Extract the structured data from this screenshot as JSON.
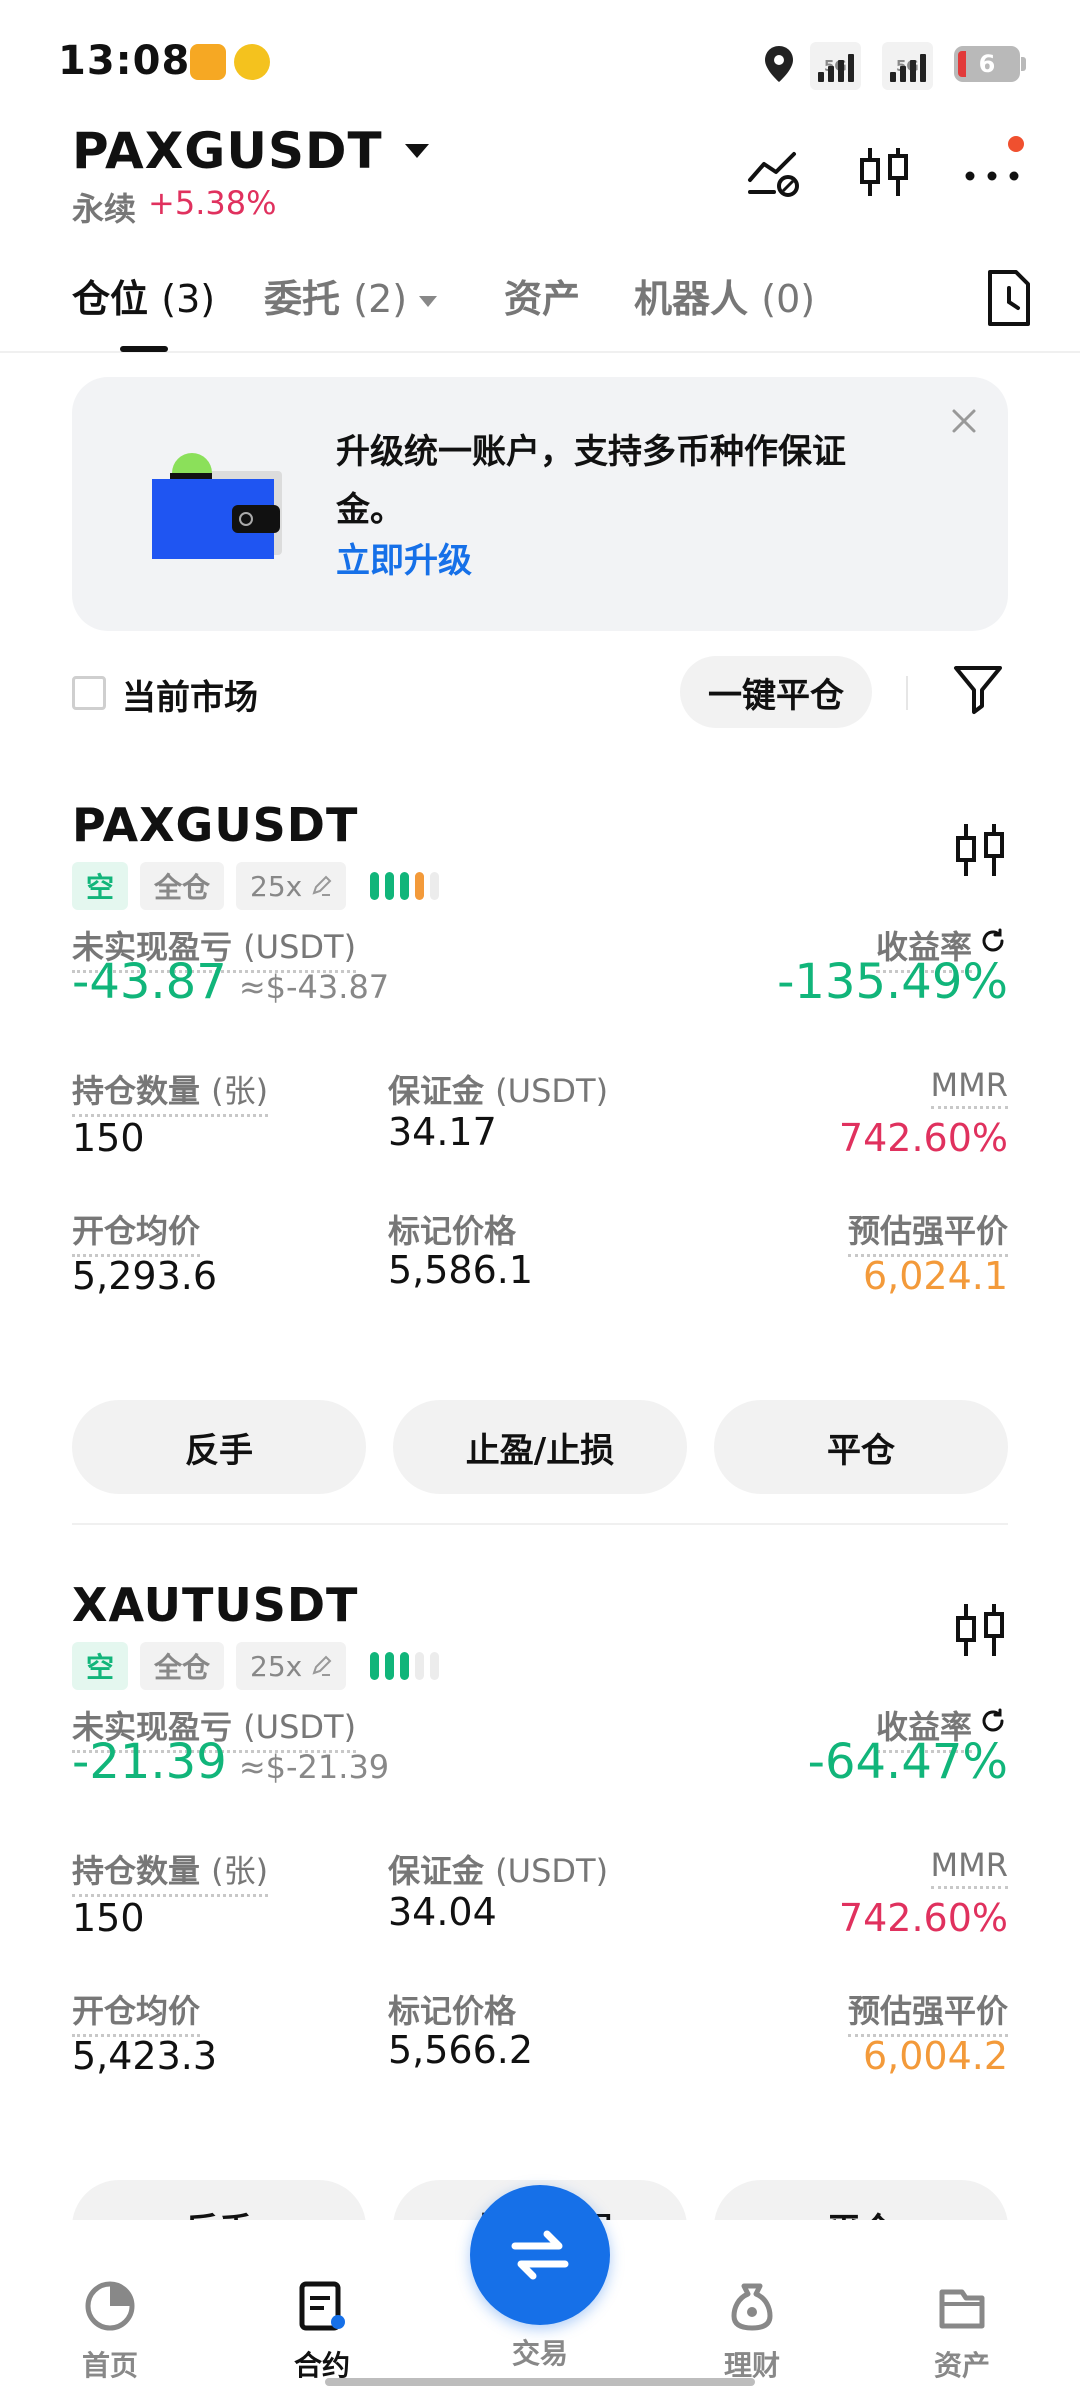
{
  "status_bar": {
    "time": "13:08",
    "signal_1": "5G",
    "signal_2": "5G",
    "battery": "6"
  },
  "header": {
    "symbol": "PAXGUSDT",
    "contract_type": "永续",
    "change": "+5.38%"
  },
  "tabs": [
    {
      "label": "仓位",
      "count": "(3)",
      "active": true
    },
    {
      "label": "委托",
      "count": "(2)"
    },
    {
      "label": "资产",
      "count": ""
    },
    {
      "label": "机器人",
      "count": "(0)"
    }
  ],
  "banner": {
    "text": "升级统一账户，支持多币种作保证金。",
    "link": "立即升级"
  },
  "filter": {
    "current_market": "当前市场",
    "close_all": "一键平仓"
  },
  "labels": {
    "unrealized_pnl": "未实现盈亏",
    "usdt_unit": "(USDT)",
    "roi": "收益率",
    "quantity": "持仓数量",
    "quantity_unit": "(张)",
    "margin": "保证金",
    "mmr": "MMR",
    "entry_price": "开仓均价",
    "mark_price": "标记价格",
    "liq_price": "预估强平价",
    "btn_reverse": "反手",
    "btn_tpsl": "止盈/止损",
    "btn_close": "平仓"
  },
  "positions": [
    {
      "symbol": "PAXGUSDT",
      "side": "空",
      "margin_mode": "全仓",
      "leverage": "25x",
      "risk_level": 4,
      "pnl": "-43.87",
      "pnl_usd": "≈$-43.87",
      "roi": "-135.49%",
      "quantity": "150",
      "margin": "34.17",
      "mmr": "742.60%",
      "entry_price": "5,293.6",
      "mark_price": "5,586.1",
      "liq_price": "6,024.1"
    },
    {
      "symbol": "XAUTUSDT",
      "side": "空",
      "margin_mode": "全仓",
      "leverage": "25x",
      "risk_level": 3,
      "pnl": "-21.39",
      "pnl_usd": "≈$-21.39",
      "roi": "-64.47%",
      "quantity": "150",
      "margin": "34.04",
      "mmr": "742.60%",
      "entry_price": "5,423.3",
      "mark_price": "5,566.2",
      "liq_price": "6,004.2"
    }
  ],
  "bottom_nav": [
    {
      "label": "首页",
      "icon": "home-icon"
    },
    {
      "label": "合约",
      "icon": "futures-icon",
      "active": true
    },
    {
      "label": "交易",
      "icon": "trade-swap-icon"
    },
    {
      "label": "理财",
      "icon": "earn-icon"
    },
    {
      "label": "资产",
      "icon": "wallet-icon"
    }
  ],
  "colors": {
    "accent": "#1670e8",
    "green": "#11b57a",
    "red": "#e0315e",
    "orange": "#f39a3a"
  }
}
